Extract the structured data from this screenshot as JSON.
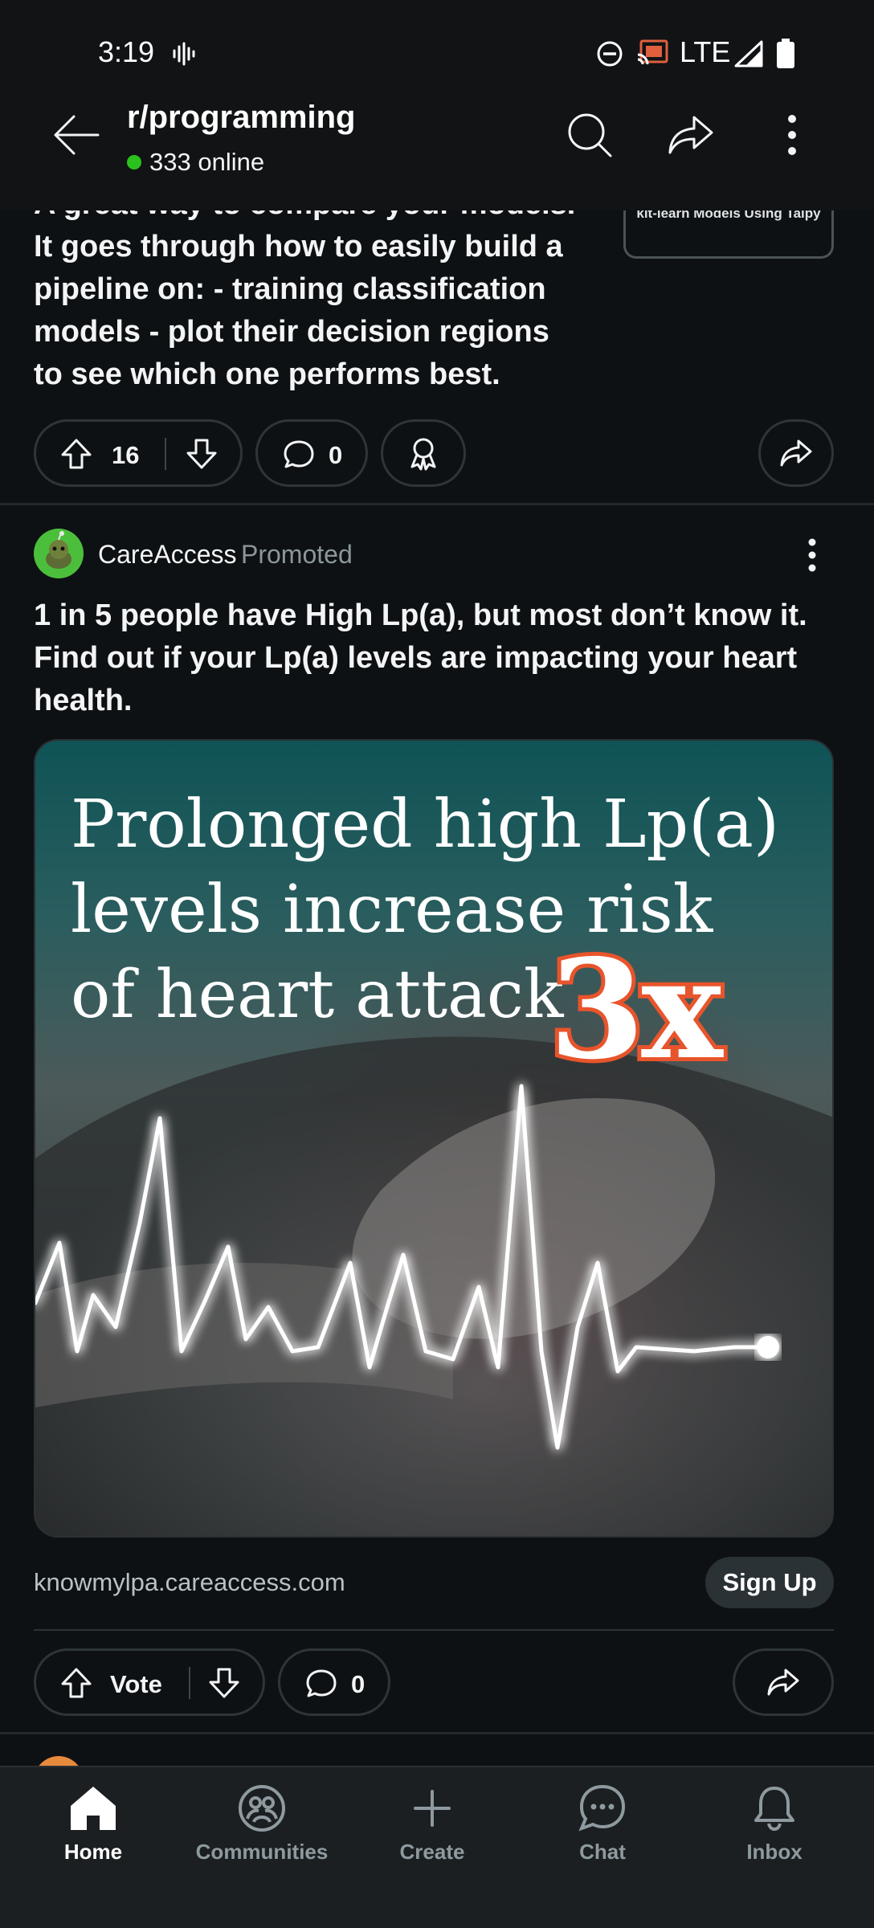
{
  "status_bar": {
    "time": "3:19",
    "network": "LTE"
  },
  "header": {
    "subreddit": "r/programming",
    "online": "333 online"
  },
  "post1": {
    "text_lines": [
      "A great way to compare your models.",
      "It goes through how to easily build a",
      "pipeline on: - training classification",
      "models - plot their decision regions",
      "to see which one performs best."
    ],
    "thumbnail_caption": "kit-learn Models Using Taipy",
    "score": "16",
    "comments": "0"
  },
  "ad": {
    "author": "CareAccess",
    "promoted_label": "Promoted",
    "title": "1 in 5 people have High Lp(a), but most don’t know it. Find out if your Lp(a) levels are impacting your heart health.",
    "image_headline": [
      "Prolonged high Lp(a)",
      "levels increase risk",
      "of heart attack"
    ],
    "image_multiplier": "3x",
    "domain": "knowmylpa.careaccess.com",
    "cta": "Sign Up",
    "vote_label": "Vote",
    "comments": "0"
  },
  "nav": {
    "home": "Home",
    "communities": "Communities",
    "create": "Create",
    "chat": "Chat",
    "inbox": "Inbox",
    "active": "Home"
  },
  "colors": {
    "background": "#0e1113",
    "online_dot": "#2bc11d",
    "accent_orange": "#e8542b",
    "muted_text": "#8c979c"
  }
}
